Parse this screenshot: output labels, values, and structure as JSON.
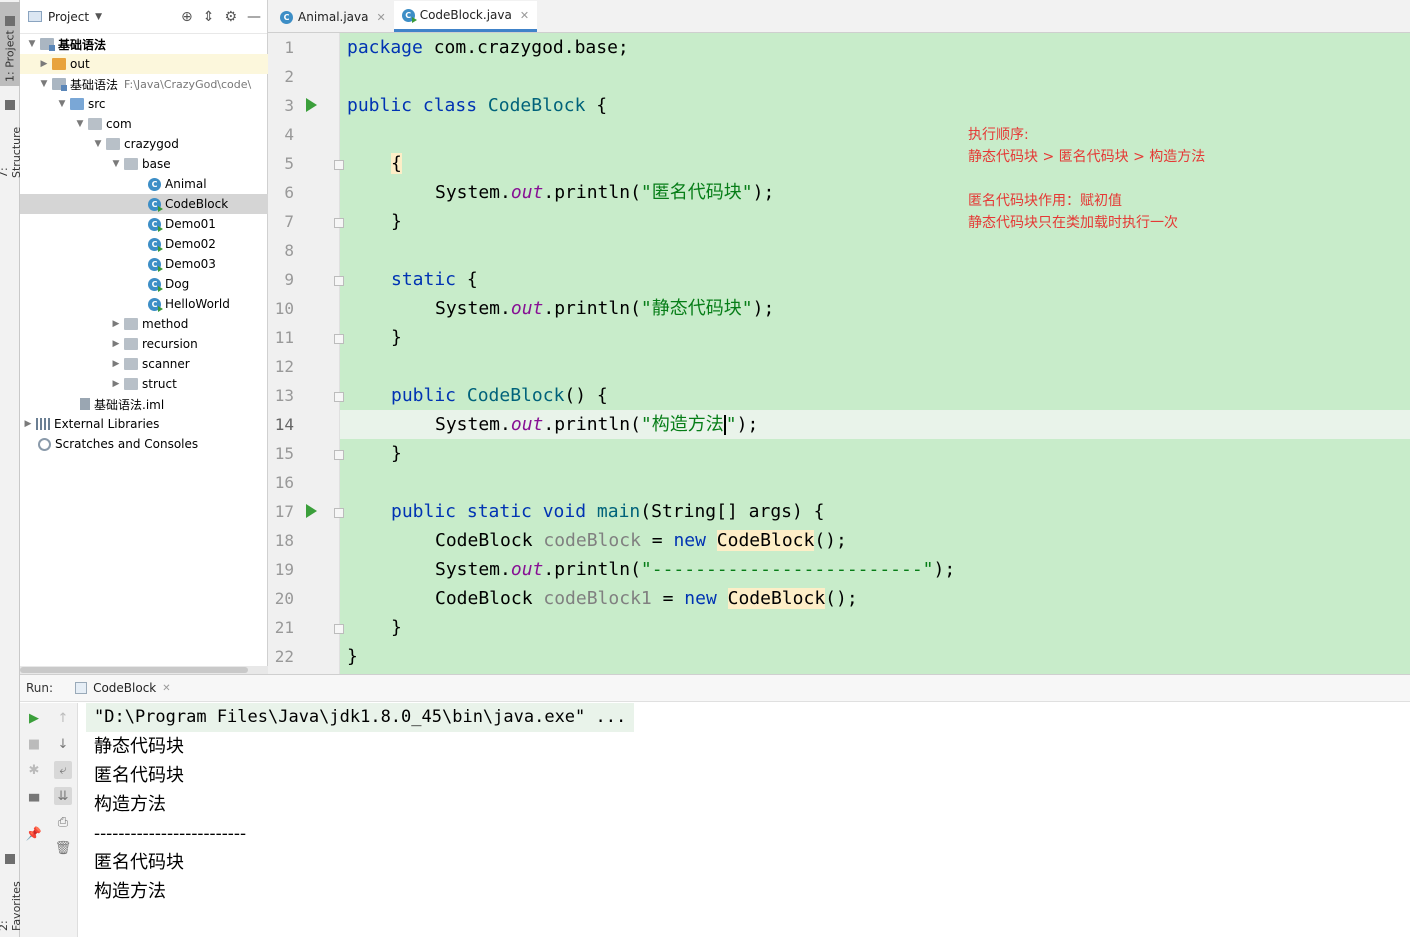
{
  "side_tabs": {
    "project": "1: Project",
    "structure": "7: Structure",
    "favorites": "2: Favorites"
  },
  "project_panel": {
    "title": "Project",
    "tree": [
      {
        "label": "基础语法",
        "kind": "module"
      },
      {
        "label": "out",
        "kind": "folder-orange"
      },
      {
        "label": "基础语法",
        "hint": "F:\\Java\\CrazyGod\\code\\",
        "kind": "module"
      },
      {
        "label": "src",
        "kind": "folder-blue"
      },
      {
        "label": "com",
        "kind": "folder"
      },
      {
        "label": "crazygod",
        "kind": "folder"
      },
      {
        "label": "base",
        "kind": "folder"
      },
      {
        "label": "Animal",
        "kind": "class"
      },
      {
        "label": "CodeBlock",
        "kind": "class-run"
      },
      {
        "label": "Demo01",
        "kind": "class-run"
      },
      {
        "label": "Demo02",
        "kind": "class-run"
      },
      {
        "label": "Demo03",
        "kind": "class-run"
      },
      {
        "label": "Dog",
        "kind": "class-run"
      },
      {
        "label": "HelloWorld",
        "kind": "class-run"
      },
      {
        "label": "method",
        "kind": "folder"
      },
      {
        "label": "recursion",
        "kind": "folder"
      },
      {
        "label": "scanner",
        "kind": "folder"
      },
      {
        "label": "struct",
        "kind": "folder"
      },
      {
        "label": "基础语法.iml",
        "kind": "iml"
      },
      {
        "label": "External Libraries",
        "kind": "lib"
      },
      {
        "label": "Scratches and Consoles",
        "kind": "scratch"
      }
    ]
  },
  "editor_tabs": [
    {
      "label": "Animal.java",
      "active": false
    },
    {
      "label": "CodeBlock.java",
      "active": true
    }
  ],
  "line_numbers": [
    "1",
    "2",
    "3",
    "4",
    "5",
    "6",
    "7",
    "8",
    "9",
    "10",
    "11",
    "12",
    "13",
    "14",
    "15",
    "16",
    "17",
    "18",
    "19",
    "20",
    "21",
    "22"
  ],
  "code": {
    "l1_kw": "package",
    "l1_rest": " com.crazygod.base;",
    "l3_kw": "public class",
    "l3_cls": "CodeBlock",
    "l3_rest": " {",
    "l5": "{",
    "l6_a": "System.",
    "l6_fld": "out",
    "l6_b": ".println(",
    "l6_str": "\"匿名代码块\"",
    "l6_c": ");",
    "l7": "}",
    "l9_kw": "static",
    "l9_rest": " {",
    "l10_a": "System.",
    "l10_fld": "out",
    "l10_b": ".println(",
    "l10_str": "\"静态代码块\"",
    "l10_c": ");",
    "l11": "}",
    "l13_kw": "public",
    "l13_cls": "CodeBlock",
    "l13_rest": "() {",
    "l14_a": "System.",
    "l14_fld": "out",
    "l14_b": ".println(",
    "l14_str1": "\"构造方法",
    "l14_str2": "\"",
    "l14_c": ");",
    "l15": "}",
    "l17_kw": "public static void",
    "l17_m": "main",
    "l17_rest": "(String[] args) {",
    "l18_a": "CodeBlock ",
    "l18_var": "codeBlock",
    "l18_b": " = ",
    "l18_kw": "new",
    "l18_ctor": "CodeBlock",
    "l18_c": "();",
    "l19_a": "System.",
    "l19_fld": "out",
    "l19_b": ".println(",
    "l19_str": "\"-------------------------\"",
    "l19_c": ");",
    "l20_a": "CodeBlock ",
    "l20_var": "codeBlock1",
    "l20_b": " = ",
    "l20_kw": "new",
    "l20_ctor": "CodeBlock",
    "l20_c": "();",
    "l21": "}",
    "l22": "}"
  },
  "notes": [
    "执行顺序:",
    "静态代码块 > 匿名代码块 > 构造方法",
    "匿名代码块作用：赋初值",
    "静态代码块只在类加载时执行一次"
  ],
  "run_panel": {
    "label": "Run:",
    "tab": "CodeBlock",
    "output": [
      "\"D:\\Program Files\\Java\\jdk1.8.0_45\\bin\\java.exe\" ...",
      "静态代码块",
      "匿名代码块",
      "构造方法",
      "-------------------------",
      "匿名代码块",
      "构造方法"
    ]
  },
  "colors": {
    "code_bg": "#c8ecca",
    "keyword": "#0033b3",
    "string": "#067d17",
    "field": "#871094",
    "note": "#e53935",
    "accent": "#4083c9"
  }
}
